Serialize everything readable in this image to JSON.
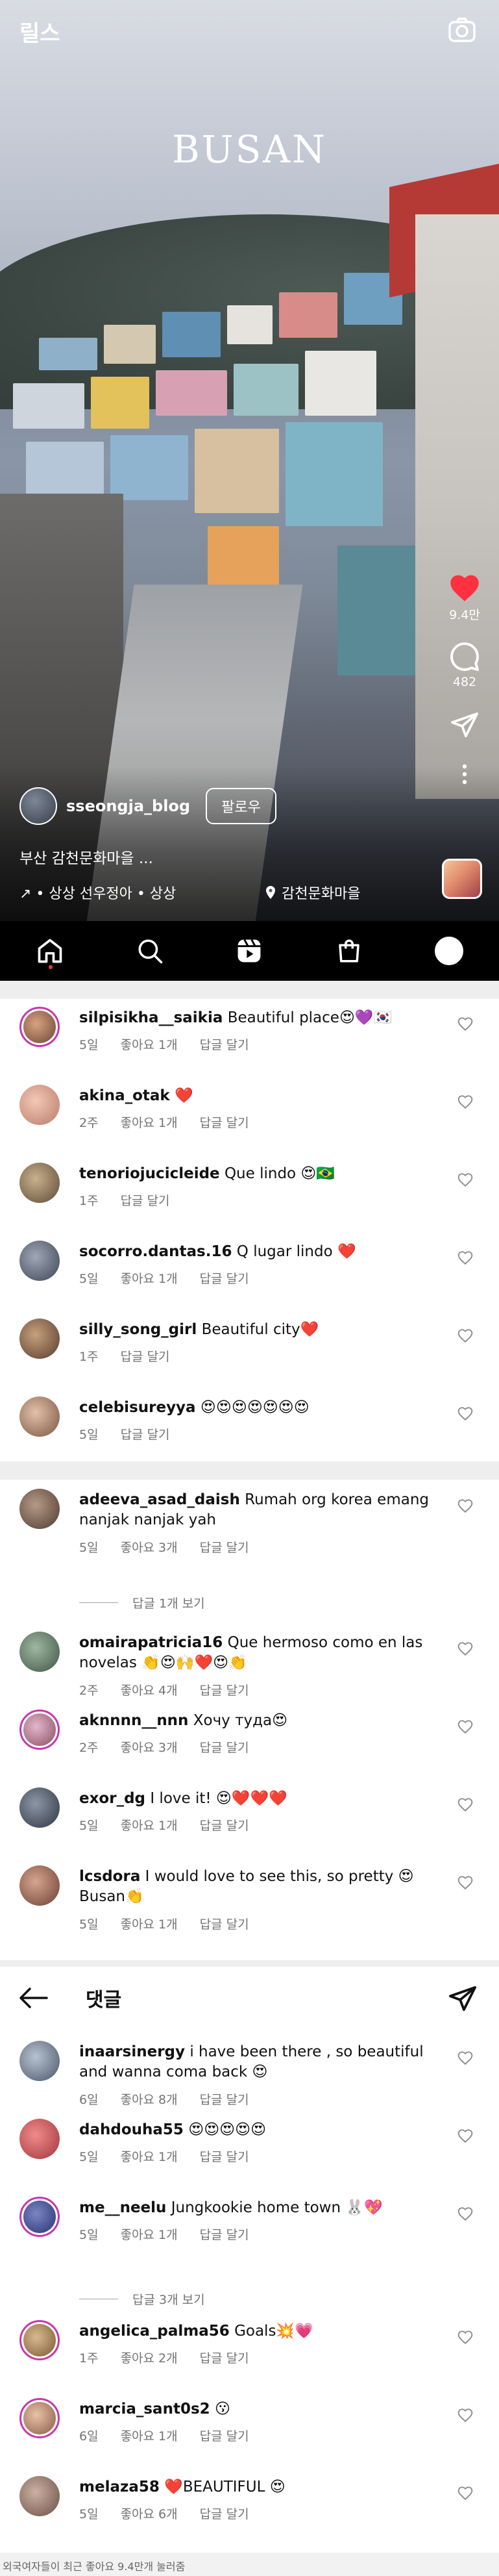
{
  "reel": {
    "header_title": "릴스",
    "video_title": "BUSAN",
    "likes_count": "9.4만",
    "comments_count": "482",
    "author_name": "sseongja_blog",
    "follow_label": "팔로우",
    "caption": "부산 감천문화마을 ...",
    "audio": "↗ • 상상   선우정아 • 상상",
    "location": "감천문화마을"
  },
  "nav": {
    "items": [
      "home-icon",
      "search-icon",
      "reels-icon",
      "shop-icon",
      "profile-avatar"
    ]
  },
  "comments_header": {
    "title": "댓글"
  },
  "comments": [
    {
      "user": "silpisikha__saikia",
      "text": "Beautiful place😍💜🇰🇷",
      "time": "5일",
      "likes": "좋아요 1개",
      "reply": "답글 달기"
    },
    {
      "user": "akina_otak",
      "text": "❤️",
      "time": "2주",
      "likes": "좋아요 1개",
      "reply": "답글 달기"
    },
    {
      "user": "tenoriojucicleide",
      "text": "Que lindo 😍🇧🇷",
      "time": "1주",
      "likes": "",
      "reply": "답글 달기"
    },
    {
      "user": "socorro.dantas.16",
      "text": "Q lugar lindo ❤️",
      "time": "5일",
      "likes": "좋아요 1개",
      "reply": "답글 달기"
    },
    {
      "user": "silly_song_girl",
      "text": "Beautiful city❤️",
      "time": "1주",
      "likes": "",
      "reply": "답글 달기"
    },
    {
      "user": "celebisureyya",
      "text": "😍😍😍😍😍😍😍",
      "time": "5일",
      "likes": "",
      "reply": "답글 달기"
    },
    {
      "user": "adeeva_asad_daish",
      "text": "Rumah org korea emang nanjak nanjak yah",
      "time": "5일",
      "likes": "좋아요 3개",
      "reply": "답글 달기",
      "replies": "답글 1개 보기"
    },
    {
      "user": "omairapatricia16",
      "text": "Que hermoso como en las novelas 👏😍🙌❤️😍👏",
      "time": "2주",
      "likes": "좋아요 4개",
      "reply": "답글 달기"
    },
    {
      "user": "aknnnn__nnn",
      "text": "Хочу туда😍",
      "time": "2주",
      "likes": "좋아요 3개",
      "reply": "답글 달기"
    },
    {
      "user": "exor_dg",
      "text": "I love it! 😍❤️❤️❤️",
      "time": "5일",
      "likes": "좋아요 1개",
      "reply": "답글 달기"
    },
    {
      "user": "lcsdora",
      "text": "I would love to see this, so pretty 😍 Busan👏",
      "time": "5일",
      "likes": "좋아요 1개",
      "reply": "답글 달기"
    },
    {
      "user": "inaarsinergy",
      "text": "i have been there , so beautiful and wanna coma back 😍",
      "time": "6일",
      "likes": "좋아요 8개",
      "reply": "답글 달기"
    },
    {
      "user": "dahdouha55",
      "text": "😍😍😍😍😍",
      "time": "5일",
      "likes": "좋아요 1개",
      "reply": "답글 달기"
    },
    {
      "user": "me__neelu",
      "text": "Jungkookie home town 🐰💖",
      "time": "5일",
      "likes": "좋아요 1개",
      "reply": "답글 달기",
      "replies": "답글 3개 보기"
    },
    {
      "user": "angelica_palma56",
      "text": "Goals💥💗",
      "time": "1주",
      "likes": "좋아요 2개",
      "reply": "답글 달기"
    },
    {
      "user": "marcia_sant0s2",
      "text": "😗",
      "time": "6일",
      "likes": "좋아요 1개",
      "reply": "답글 달기"
    },
    {
      "user": "melaza58",
      "text": "❤️BEAUTIFUL 😍",
      "time": "5일",
      "likes": "좋아요 6개",
      "reply": "답글 달기"
    }
  ],
  "footer": "외국여자들이 최근 좋아요 9.4만개 눌러줌",
  "colors": {
    "like_red": "#ff3040",
    "story_ring": "#c837ab",
    "muted": "#737373"
  }
}
